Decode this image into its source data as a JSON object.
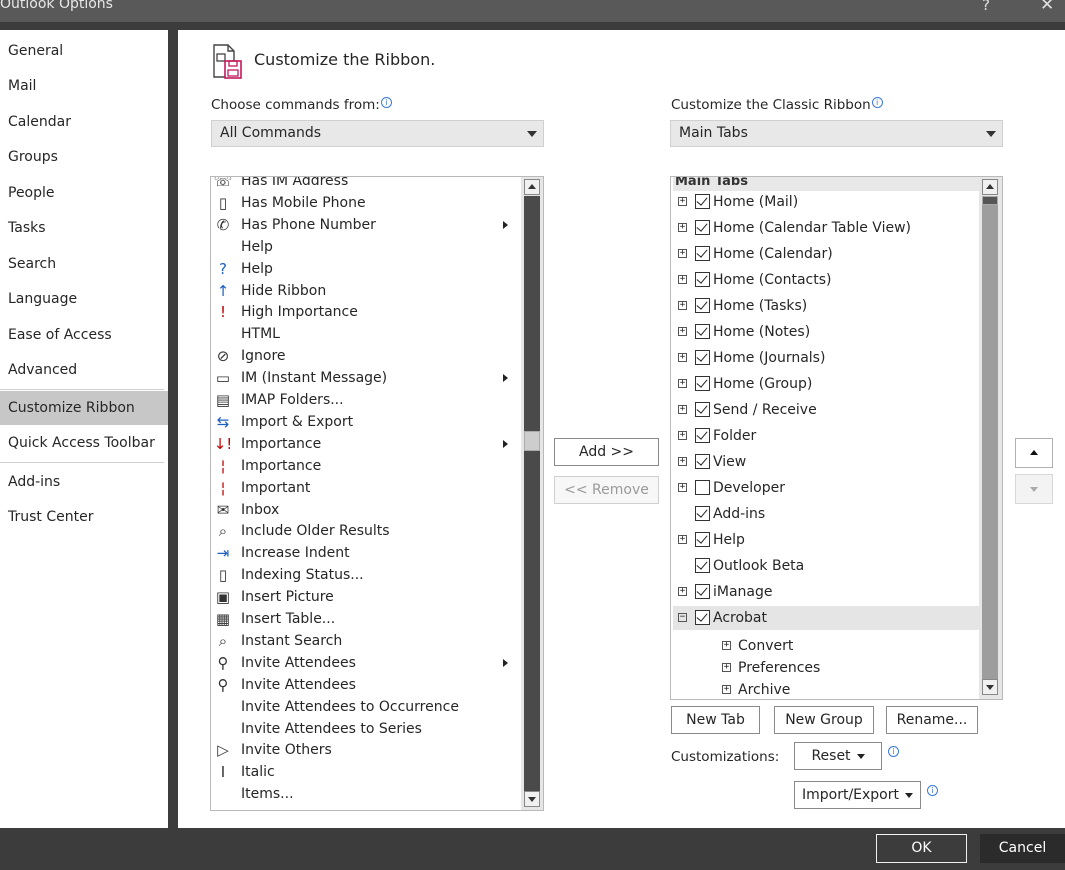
{
  "window": {
    "title": "Outlook Options",
    "help": "?",
    "close": "✕"
  },
  "sidebar": {
    "items": [
      {
        "label": "General"
      },
      {
        "label": "Mail"
      },
      {
        "label": "Calendar"
      },
      {
        "label": "Groups"
      },
      {
        "label": "People"
      },
      {
        "label": "Tasks"
      },
      {
        "label": "Search"
      },
      {
        "label": "Language"
      },
      {
        "label": "Ease of Access"
      },
      {
        "label": "Advanced"
      },
      {
        "label": "Customize Ribbon"
      },
      {
        "label": "Quick Access Toolbar"
      },
      {
        "label": "Add-ins"
      },
      {
        "label": "Trust Center"
      }
    ],
    "active": "Customize Ribbon"
  },
  "page": {
    "heading": "Customize the Ribbon.",
    "left": {
      "label": "Choose commands from:",
      "dropdown_value": "All Commands",
      "commands": [
        {
          "label": "Has IM Address",
          "icon": "im-address-icon",
          "glyph": "☏"
        },
        {
          "label": "Has Mobile Phone",
          "icon": "mobile-phone-icon",
          "glyph": "▯"
        },
        {
          "label": "Has Phone Number",
          "icon": "phone-icon",
          "glyph": "✆",
          "submenu": true
        },
        {
          "label": "Help",
          "icon": "",
          "glyph": ""
        },
        {
          "label": "Help",
          "icon": "help-circle-icon",
          "glyph": "?"
        },
        {
          "label": "Hide Ribbon",
          "icon": "hide-ribbon-icon",
          "glyph": "↑"
        },
        {
          "label": "High Importance",
          "icon": "high-importance-icon",
          "glyph": "!"
        },
        {
          "label": "HTML",
          "icon": "",
          "glyph": ""
        },
        {
          "label": "Ignore",
          "icon": "ignore-icon",
          "glyph": "⊘"
        },
        {
          "label": "IM (Instant Message)",
          "icon": "instant-message-icon",
          "glyph": "▭",
          "submenu": true
        },
        {
          "label": "IMAP Folders...",
          "icon": "imap-folders-icon",
          "glyph": "▤"
        },
        {
          "label": "Import & Export",
          "icon": "import-export-icon",
          "glyph": "⇆"
        },
        {
          "label": "Importance",
          "icon": "importance-icon",
          "glyph": "↓!",
          "submenu": true
        },
        {
          "label": "Importance",
          "icon": "importance-red-icon",
          "glyph": "¦"
        },
        {
          "label": "Important",
          "icon": "important-icon",
          "glyph": "¦"
        },
        {
          "label": "Inbox",
          "icon": "inbox-icon",
          "glyph": "✉"
        },
        {
          "label": "Include Older Results",
          "icon": "older-results-icon",
          "glyph": "⌕"
        },
        {
          "label": "Increase Indent",
          "icon": "increase-indent-icon",
          "glyph": "⇥"
        },
        {
          "label": "Indexing Status...",
          "icon": "indexing-status-icon",
          "glyph": "▯"
        },
        {
          "label": "Insert Picture",
          "icon": "insert-picture-icon",
          "glyph": "▣"
        },
        {
          "label": "Insert Table...",
          "icon": "insert-table-icon",
          "glyph": "▦"
        },
        {
          "label": "Instant Search",
          "icon": "instant-search-icon",
          "glyph": "⌕"
        },
        {
          "label": "Invite Attendees",
          "icon": "invite-attendees-icon",
          "glyph": "⚲",
          "submenu": true
        },
        {
          "label": "Invite Attendees",
          "icon": "invite-attendees-icon",
          "glyph": "⚲"
        },
        {
          "label": "Invite Attendees to Occurrence",
          "icon": "",
          "glyph": ""
        },
        {
          "label": "Invite Attendees to Series",
          "icon": "",
          "glyph": ""
        },
        {
          "label": "Invite Others",
          "icon": "send-icon",
          "glyph": "▷"
        },
        {
          "label": "Italic",
          "icon": "italic-icon",
          "glyph": "I"
        },
        {
          "label": "Items...",
          "icon": "",
          "glyph": ""
        }
      ]
    },
    "middle": {
      "add": "Add >>",
      "remove": "<< Remove"
    },
    "right": {
      "label": "Customize the Classic Ribbon",
      "dropdown_value": "Main Tabs",
      "tree_header": "Main Tabs",
      "tree": [
        {
          "label": "Home (Mail)",
          "expander": "+",
          "checked": true
        },
        {
          "label": "Home (Calendar Table View)",
          "expander": "+",
          "checked": true
        },
        {
          "label": "Home (Calendar)",
          "expander": "+",
          "checked": true
        },
        {
          "label": "Home (Contacts)",
          "expander": "+",
          "checked": true
        },
        {
          "label": "Home (Tasks)",
          "expander": "+",
          "checked": true
        },
        {
          "label": "Home (Notes)",
          "expander": "+",
          "checked": true
        },
        {
          "label": "Home (Journals)",
          "expander": "+",
          "checked": true
        },
        {
          "label": "Home (Group)",
          "expander": "+",
          "checked": true
        },
        {
          "label": "Send / Receive",
          "expander": "+",
          "checked": true
        },
        {
          "label": "Folder",
          "expander": "+",
          "checked": true
        },
        {
          "label": "View",
          "expander": "+",
          "checked": true
        },
        {
          "label": "Developer",
          "expander": "+",
          "checked": false
        },
        {
          "label": "Add-ins",
          "expander": "",
          "checked": true
        },
        {
          "label": "Help",
          "expander": "+",
          "checked": true
        },
        {
          "label": "Outlook Beta",
          "expander": "",
          "checked": true
        },
        {
          "label": "iManage",
          "expander": "+",
          "checked": true
        },
        {
          "label": "Acrobat",
          "expander": "−",
          "checked": true,
          "selected": true
        }
      ],
      "subtree": [
        {
          "label": "Convert"
        },
        {
          "label": "Preferences"
        },
        {
          "label": "Archive"
        }
      ],
      "new_tab": "New Tab",
      "new_group": "New Group",
      "rename": "Rename...",
      "customizations_label": "Customizations:",
      "reset": "Reset",
      "import_export": "Import/Export"
    }
  },
  "footer": {
    "ok": "OK",
    "cancel": "Cancel"
  }
}
